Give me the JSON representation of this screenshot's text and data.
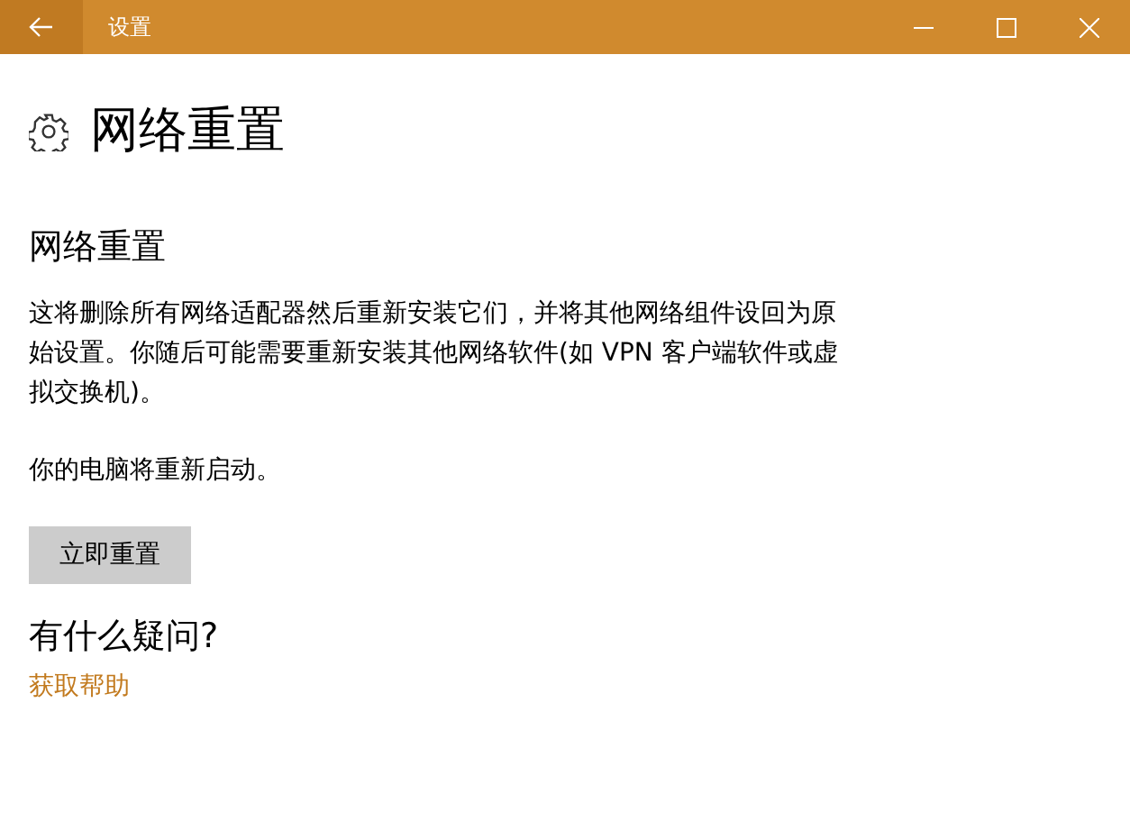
{
  "window": {
    "title": "设置"
  },
  "page": {
    "title": "网络重置"
  },
  "section": {
    "title": "网络重置",
    "description": "这将删除所有网络适配器然后重新安装它们，并将其他网络组件设回为原始设置。你随后可能需要重新安装其他网络软件(如 VPN 客户端软件或虚拟交换机)。",
    "note": "你的电脑将重新启动。",
    "button": "立即重置"
  },
  "help": {
    "title": "有什么疑问?",
    "link": "获取帮助"
  }
}
